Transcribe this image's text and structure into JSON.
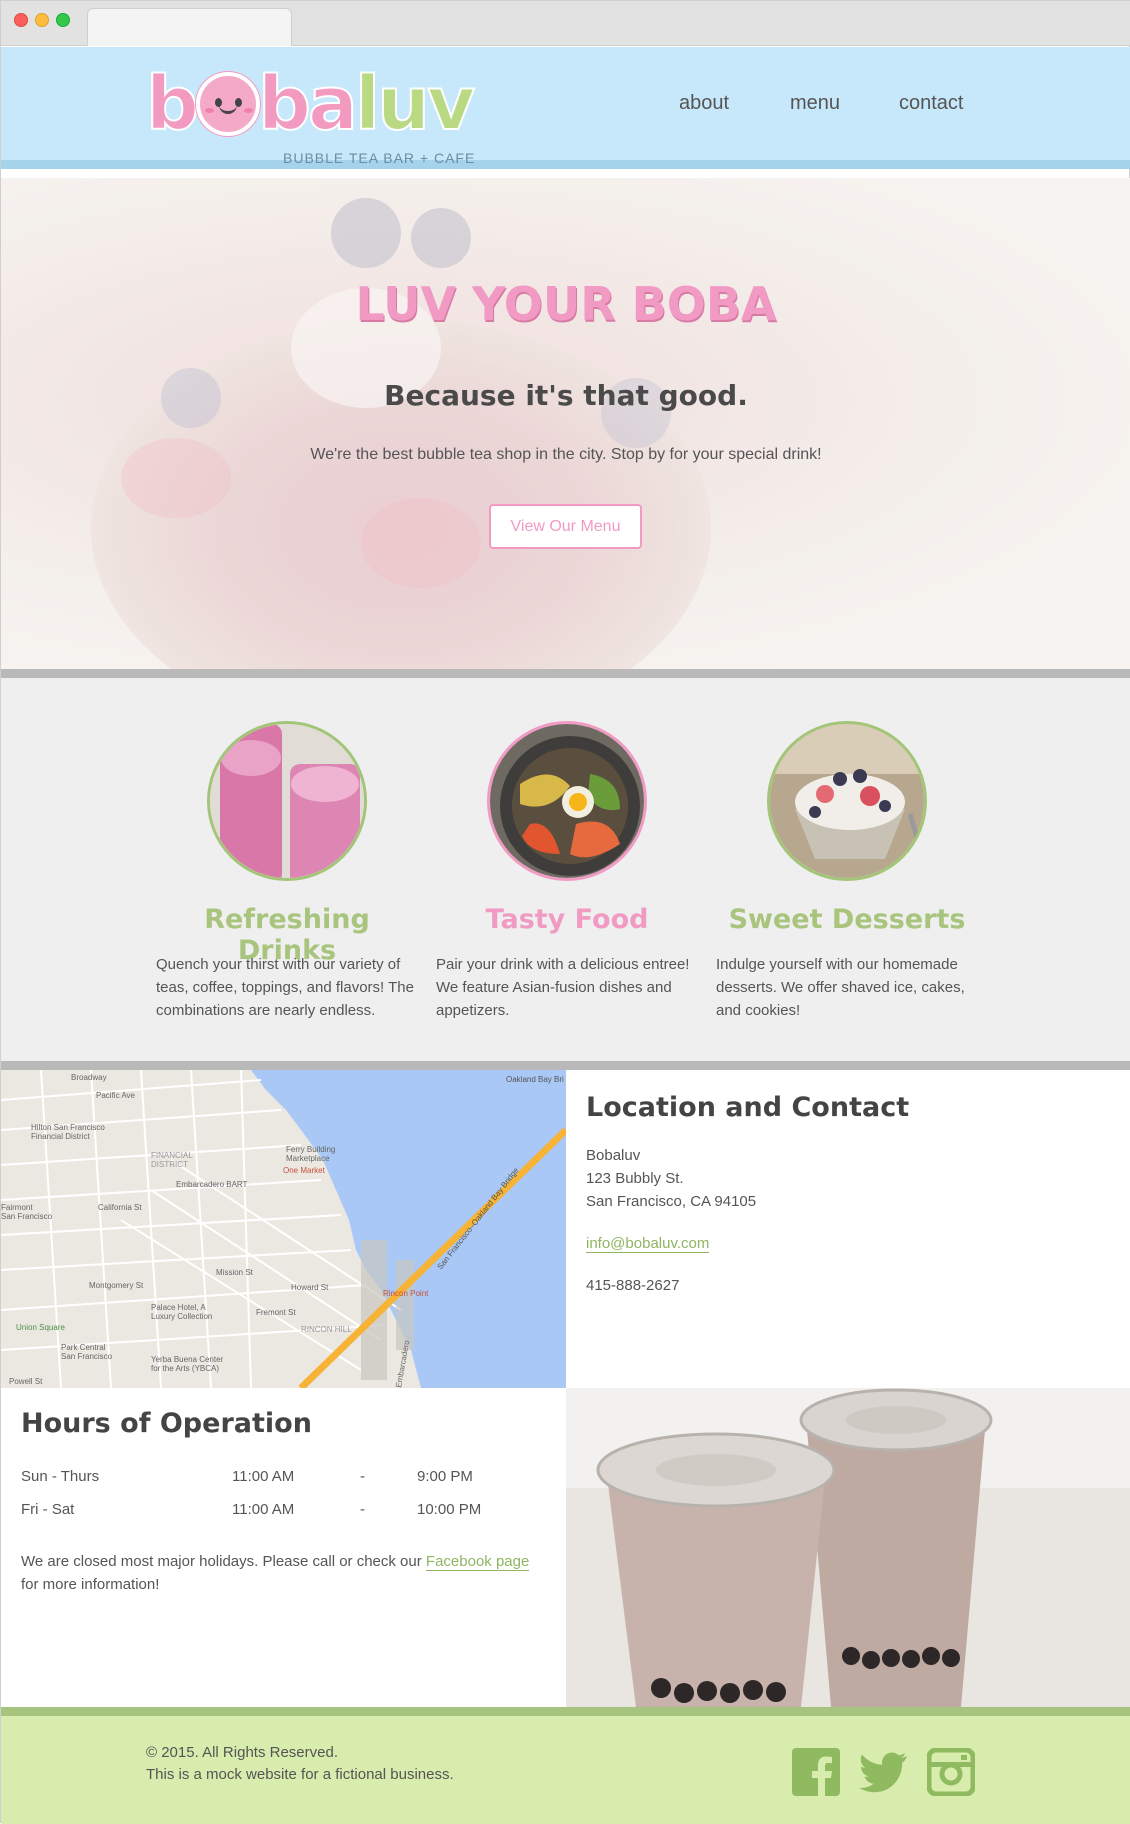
{
  "brand": {
    "logo_text_part1": "b",
    "logo_text_part2": "ba",
    "logo_text_part3": "luv",
    "tagline": "BUBBLE TEA BAR + CAFE"
  },
  "nav": {
    "items": [
      {
        "label": "about"
      },
      {
        "label": "menu"
      },
      {
        "label": "contact"
      }
    ]
  },
  "hero": {
    "title": "LUV YOUR BOBA",
    "subtitle": "Because it's that good.",
    "text": "We're the best bubble tea shop in the city. Stop by for your special drink!",
    "button_label": "View Our Menu"
  },
  "features": [
    {
      "title": "Refreshing Drinks",
      "text": "Quench your thirst with our variety of teas, coffee, toppings, and flavors! The combinations are nearly endless."
    },
    {
      "title": "Tasty Food",
      "text": "Pair your drink with a delicious entree! We feature Asian-fusion dishes and appetizers."
    },
    {
      "title": "Sweet Desserts",
      "text": "Indulge yourself with our homemade desserts. We offer shaved ice, cakes, and cookies!"
    }
  ],
  "map": {
    "labels": [
      "Broadway",
      "Pacific Ave",
      "FINANCIAL DISTRICT",
      "Embarcadero BART",
      "California St",
      "Ferry Building Marketplace",
      "One Market",
      "Montgomery St",
      "Palace Hotel, A Luxury Collection",
      "Union Square",
      "Park Central San Francisco",
      "Yerba Buena Center for the Arts (YBCA)",
      "RINCON HILL",
      "Rincon Point",
      "San Francisco–Oakland Bay Bridge",
      "Oakland Bay Bri",
      "Hilton San Francisco Financial District",
      "Fairmont San Francisco",
      "Powell St",
      "Mission St",
      "Howard St",
      "Fremont St",
      "Embarcadero"
    ]
  },
  "location": {
    "heading": "Location and Contact",
    "name": "Bobaluv",
    "street": "123 Bubbly St.",
    "city": "San Francisco, CA 94105",
    "email": "info@bobaluv.com",
    "phone": "415-888-2627"
  },
  "hours": {
    "heading": "Hours of Operation",
    "rows": [
      {
        "days": "Sun - Thurs",
        "open": "11:00 AM",
        "sep": "-",
        "close": "9:00 PM"
      },
      {
        "days": "Fri - Sat",
        "open": "11:00 AM",
        "sep": "-",
        "close": "10:00 PM"
      }
    ],
    "note_before": "We are closed most major holidays. Please call or check our ",
    "note_link": "Facebook page",
    "note_after": "for more information!"
  },
  "footer": {
    "copyright": "© 2015. All Rights Reserved.",
    "disclaimer": "This is a mock website for a fictional business.",
    "social_icons": [
      "facebook-icon",
      "twitter-icon",
      "instagram-icon"
    ]
  },
  "colors": {
    "header_bg": "#c6e8fa",
    "pink_accent": "#f19ac3",
    "green_accent": "#a8c47d",
    "footer_bg": "#d8ecae",
    "feature_bg": "#efefef"
  }
}
